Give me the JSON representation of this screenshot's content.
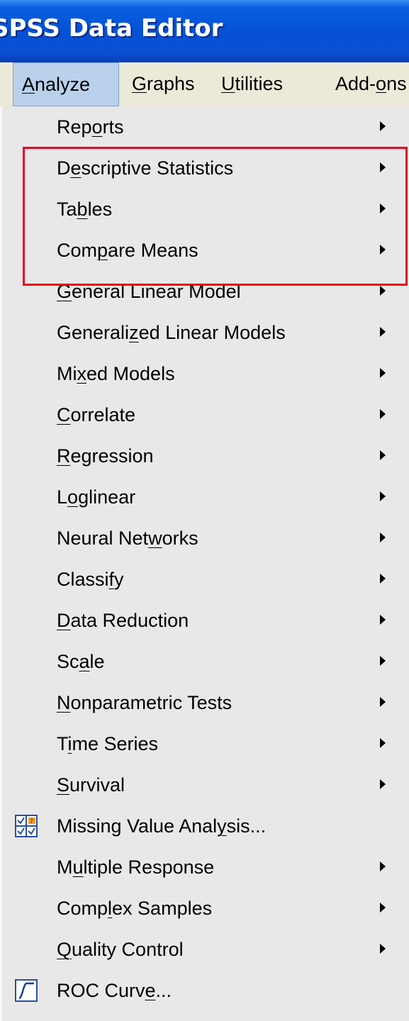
{
  "window": {
    "title": "SPSS Data Editor"
  },
  "menubar": {
    "items": [
      {
        "label": "Analyze",
        "underline_char": "A",
        "active": true
      },
      {
        "label": "Graphs",
        "underline_char": "G",
        "active": false
      },
      {
        "label": "Utilities",
        "underline_char": "U",
        "active": false
      },
      {
        "label": "Add-ons",
        "underline_char": "o",
        "active": false
      }
    ]
  },
  "menu": {
    "items": [
      {
        "label": "Reports",
        "underline_index": 3,
        "submenu": true,
        "icon": null
      },
      {
        "label": "Descriptive Statistics",
        "underline_index": 1,
        "submenu": true,
        "icon": null
      },
      {
        "label": "Tables",
        "underline_index": 2,
        "submenu": true,
        "icon": null
      },
      {
        "label": "Compare Means",
        "underline_index": 3,
        "submenu": true,
        "icon": null
      },
      {
        "label": "General Linear Model",
        "underline_index": 0,
        "submenu": true,
        "icon": null
      },
      {
        "label": "Generalized Linear Models",
        "underline_index": 8,
        "submenu": true,
        "icon": null
      },
      {
        "label": "Mixed Models",
        "underline_index": 2,
        "submenu": true,
        "icon": null
      },
      {
        "label": "Correlate",
        "underline_index": 0,
        "submenu": true,
        "icon": null
      },
      {
        "label": "Regression",
        "underline_index": 0,
        "submenu": true,
        "icon": null
      },
      {
        "label": "Loglinear",
        "underline_index": 1,
        "submenu": true,
        "icon": null
      },
      {
        "label": "Neural Networks",
        "underline_index": 10,
        "submenu": true,
        "icon": null
      },
      {
        "label": "Classify",
        "underline_index": 6,
        "submenu": true,
        "icon": null
      },
      {
        "label": "Data Reduction",
        "underline_index": 0,
        "submenu": true,
        "icon": null
      },
      {
        "label": "Scale",
        "underline_index": 2,
        "submenu": true,
        "icon": null
      },
      {
        "label": "Nonparametric Tests",
        "underline_index": 0,
        "submenu": true,
        "icon": null
      },
      {
        "label": "Time Series",
        "underline_index": 1,
        "submenu": true,
        "icon": null
      },
      {
        "label": "Survival",
        "underline_index": 0,
        "submenu": true,
        "icon": null
      },
      {
        "label": "Missing Value Analysis...",
        "underline_index": 18,
        "submenu": false,
        "icon": "missing-value-icon"
      },
      {
        "label": "Multiple Response",
        "underline_index": 1,
        "submenu": true,
        "icon": null
      },
      {
        "label": "Complex Samples",
        "underline_index": 4,
        "submenu": true,
        "icon": null
      },
      {
        "label": "Quality Control",
        "underline_index": 0,
        "submenu": true,
        "icon": null
      },
      {
        "label": "ROC Curve...",
        "underline_index": 8,
        "submenu": false,
        "icon": "roc-curve-icon"
      }
    ]
  },
  "annotation": {
    "highlight_color": "#e3001b",
    "highlighted_items": [
      "Descriptive Statistics",
      "Tables",
      "Compare Means"
    ]
  },
  "colors": {
    "titlebar": "#0551d6",
    "menubar_bg": "#ece9d8",
    "menu_bg": "#e8e8e8",
    "active_menu_bg": "#b9d1ea"
  }
}
